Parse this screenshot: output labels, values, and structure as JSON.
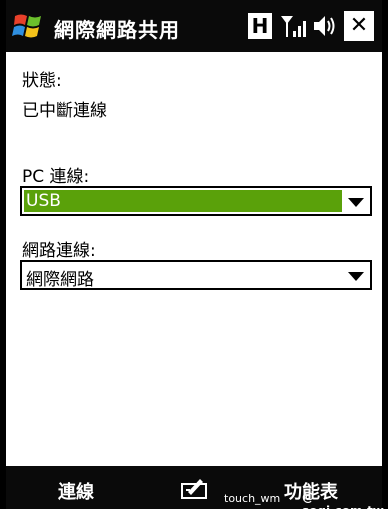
{
  "titlebar": {
    "title": "網際網路共用",
    "status_h": "H",
    "close_label": "✕"
  },
  "content": {
    "status_label": "狀態:",
    "status_value": "已中斷連線",
    "pc_label": "PC 連線:",
    "pc_value": "USB",
    "net_label": "網路連線:",
    "net_value": "網際網路"
  },
  "softkeys": {
    "left": "連線",
    "right": "功能表"
  },
  "watermark": {
    "left": "touch_wm",
    "right": "@ sogi.com.tw"
  },
  "colors": {
    "selection": "#5aa10a",
    "bar": "#0a0a0a"
  }
}
